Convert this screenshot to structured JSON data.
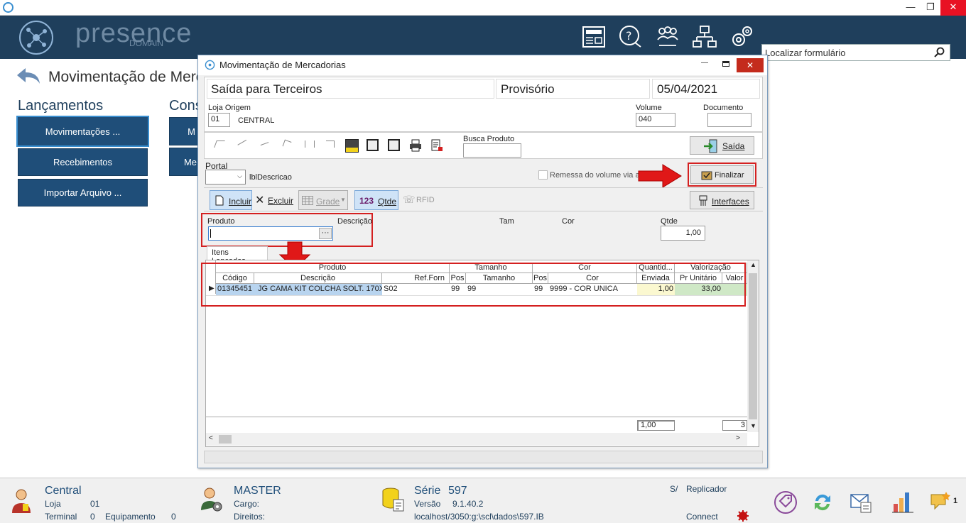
{
  "window": {
    "min": "—",
    "restore": "❐",
    "close": "✕"
  },
  "header": {
    "logo_main": "presence",
    "logo_sub": "DOMAIN",
    "search_placeholder": "Localizar formulário"
  },
  "page": {
    "title": "Movimentação de Merc",
    "sections": {
      "left": "Lançamentos",
      "right": "Cons"
    }
  },
  "nav": {
    "left": [
      "Movimentações ...",
      "Recebimentos",
      "Importar Arquivo ..."
    ],
    "right": [
      "M",
      "Me"
    ]
  },
  "dialog": {
    "title": "Movimentação de Mercadorias",
    "op_type": "Saída para Terceiros",
    "status": "Provisório",
    "date": "05/04/2021",
    "loja_label": "Loja Origem",
    "loja_code": "01",
    "loja_name": "CENTRAL",
    "volume_label": "Volume",
    "volume_value": "040",
    "documento_label": "Documento",
    "documento_value": "",
    "busca_label": "Busca Produto",
    "saida_btn": "Saída",
    "portal_label": "Portal",
    "lbl_descricao": "lblDescricao",
    "remessa_label": "Remessa do volume via ar",
    "finalizar_btn": "Finalizar",
    "interfaces_btn": "Interfaces",
    "incluir": "Incluir",
    "excluir": "Excluir",
    "grade": "Grade",
    "qtde_num": "123",
    "qtde": "Qtde",
    "rfid": "RFID",
    "produto_label": "Produto",
    "descricao_label": "Descrição",
    "tam_label": "Tam",
    "cor_label": "Cor",
    "qtde_label": "Qtde",
    "qtde_value": "1,00",
    "tab": "Itens Lançados",
    "groups": [
      "Produto",
      "Tamanho",
      "Cor",
      "Quantid...",
      "Valorização"
    ],
    "columns": [
      "Código",
      "Descrição",
      "Ref.Forn",
      "Pos",
      "Tamanho",
      "Pos",
      "Cor",
      "Enviada",
      "Pr Unitário",
      "Valor"
    ],
    "rows": [
      [
        "01345451",
        "JG CAMA KIT COLCHA SOLT. 170X",
        "S02",
        "99",
        "99",
        "99",
        "9999 - COR UNICA",
        "1,00",
        "33,00",
        ""
      ]
    ],
    "total_qtde": "1,00",
    "total_valor": "3"
  },
  "status": {
    "loja_name": "Central",
    "loja_label": "Loja",
    "loja_val": "01",
    "terminal_label": "Terminal",
    "terminal_val": "0",
    "equip_label": "Equipamento",
    "equip_val": "0",
    "user": "MASTER",
    "cargo": "Cargo:",
    "direitos": "Direitos:",
    "serie_label": "Série",
    "serie_val": "597",
    "versao_label": "Versão",
    "versao_val": "9.1.40.2",
    "db_path": "localhost/3050:g:\\scl\\dados\\597.IB",
    "sa": "S/",
    "replicador": "Replicador",
    "connect": "Connect",
    "notif_count": "1"
  },
  "colors": {
    "header": "#1f3f5c",
    "nav": "#1f4e79",
    "accent_red": "#d42020"
  }
}
